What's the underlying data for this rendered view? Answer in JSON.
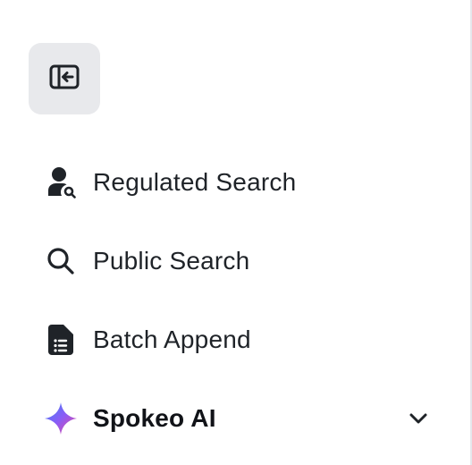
{
  "sidebar": {
    "collapse_button_icon": "collapse-sidebar-icon",
    "items": [
      {
        "label": "Regulated Search",
        "icon": "person-search-icon"
      },
      {
        "label": "Public Search",
        "icon": "search-icon"
      },
      {
        "label": "Batch Append",
        "icon": "document-list-icon"
      },
      {
        "label": "Spokeo AI",
        "icon": "sparkle-icon",
        "expandable": true
      }
    ]
  },
  "colors": {
    "text": "#1f2328",
    "icon": "#1f2328",
    "button_bg": "#e8e9ec",
    "border": "#e5e7eb",
    "sparkle_gradient": [
      "#3b82f6",
      "#8b5cf6",
      "#ec4899"
    ]
  }
}
